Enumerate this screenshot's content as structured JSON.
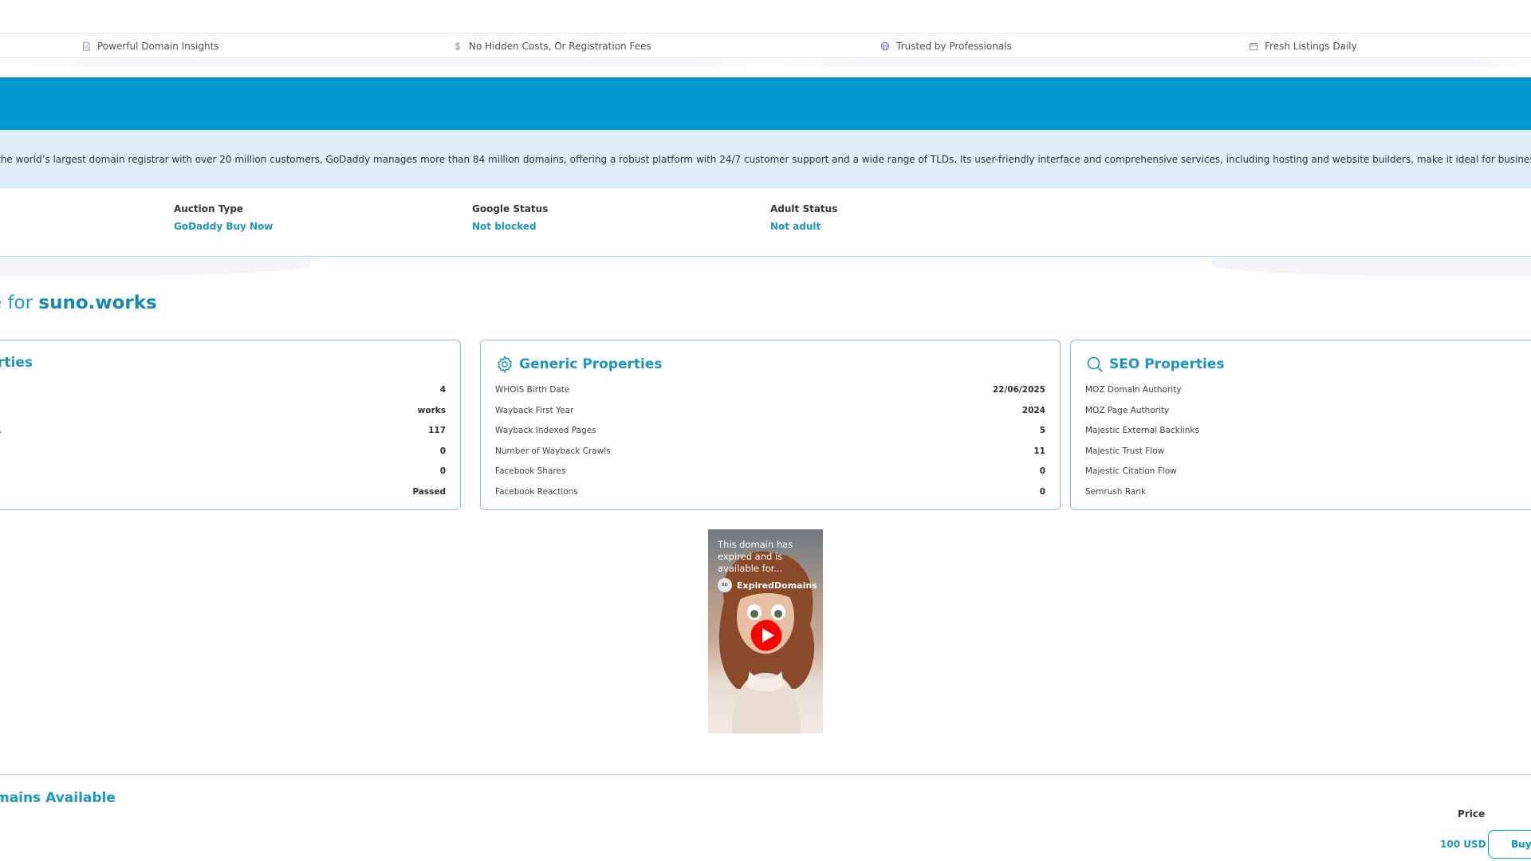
{
  "features": [
    {
      "icon": "document-icon",
      "label": "Powerful Domain Insights"
    },
    {
      "icon": "dollar-icon",
      "label": "No Hidden Costs, Or Registration Fees"
    },
    {
      "icon": "globe-icon",
      "label": "Trusted by Professionals"
    },
    {
      "icon": "calendar-icon",
      "label": "Fresh Listings Daily"
    }
  ],
  "registrar": {
    "description": "s the world’s largest domain registrar with over 20 million customers, GoDaddy manages more than 84 million domains, offering a robust platform with 24/7 customer support and a wide range of TLDs. Its user-friendly interface and comprehensive services, including hosting and website builders, make it ideal for businesses seeking an all-in-one solu"
  },
  "statuses": [
    {
      "label": "Auction Type",
      "value": "GoDaddy Buy Now"
    },
    {
      "label": "Google Status",
      "value": "Not blocked"
    },
    {
      "label": "Adult Status",
      "value": "Not adult"
    }
  ],
  "section": {
    "prefix": "e for",
    "domain": "suno.works"
  },
  "cards": {
    "left": {
      "title": "rties",
      "rows": [
        {
          "label": "",
          "value": "4"
        },
        {
          "label": "",
          "value": "works"
        },
        {
          "label": ".",
          "value": "117"
        },
        {
          "label": "",
          "value": "0"
        },
        {
          "label": "",
          "value": "0"
        },
        {
          "label": "",
          "value": "Passed"
        }
      ]
    },
    "generic": {
      "title": "Generic Properties",
      "icon": "gear-icon",
      "rows": [
        {
          "label": "WHOIS Birth Date",
          "value": "22/06/2025"
        },
        {
          "label": "Wayback First Year",
          "value": "2024"
        },
        {
          "label": "Wayback Indexed Pages",
          "value": "5"
        },
        {
          "label": "Number of Wayback Crawls",
          "value": "11"
        },
        {
          "label": "Facebook Shares",
          "value": "0"
        },
        {
          "label": "Facebook Reactions",
          "value": "0"
        }
      ]
    },
    "seo": {
      "title": "SEO Properties",
      "icon": "search-icon",
      "rows": [
        {
          "label": "MOZ Domain Authority",
          "value": ""
        },
        {
          "label": "MOZ Page Authority",
          "value": ""
        },
        {
          "label": "Majestic External Backlinks",
          "value": ""
        },
        {
          "label": "Majestic Trust Flow",
          "value": ""
        },
        {
          "label": "Majestic Citation Flow",
          "value": ""
        },
        {
          "label": "Semrush Rank",
          "value": ""
        }
      ]
    }
  },
  "video": {
    "caption": "This domain has expired and is available for...",
    "channel": "ExpiredDomains",
    "channel_badge": "ED"
  },
  "domains_list": {
    "title": "mains Available",
    "price_header": "Price",
    "price_value": "100 USD",
    "buy_label": "Buy"
  },
  "colors": {
    "accent": "#0098cf",
    "accent_text": "#1a96c1",
    "light_strip": "#deeefa",
    "card_border": "#8ac7dd"
  }
}
